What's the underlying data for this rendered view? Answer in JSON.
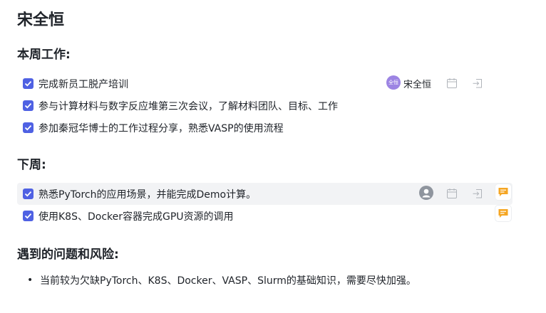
{
  "doc": {
    "title": "宋全恒"
  },
  "sections": {
    "this_week": "本周工作:",
    "next_week": "下周:",
    "risks": "遇到的问题和风险:"
  },
  "this_week_tasks": [
    {
      "text": "完成新员工脱产培训",
      "checked": true,
      "assignee": {
        "avatar_text": "全恒",
        "name": "宋全恒"
      }
    },
    {
      "text": "参与计算材料与数字反应堆第三次会议，了解材料团队、目标、工作",
      "checked": true
    },
    {
      "text": "参加秦冠华博士的工作过程分享，熟悉VASP的使用流程",
      "checked": true
    }
  ],
  "next_week_tasks": [
    {
      "text": "熟悉PyTorch的应用场景，并能完成Demo计算。",
      "checked": true
    },
    {
      "text": "使用K8S、Docker容器完成GPU资源的调用",
      "checked": true
    }
  ],
  "risks": [
    {
      "text": "当前较为欠缺PyTorch、K8S、Docker、VASP、Slurm的基础知识，需要尽快加强。"
    }
  ],
  "colors": {
    "checkbox": "#4f61e3",
    "avatar": "#9c84e3",
    "comment_icon": "#f5a623",
    "hover_row": "#f2f3f5"
  }
}
